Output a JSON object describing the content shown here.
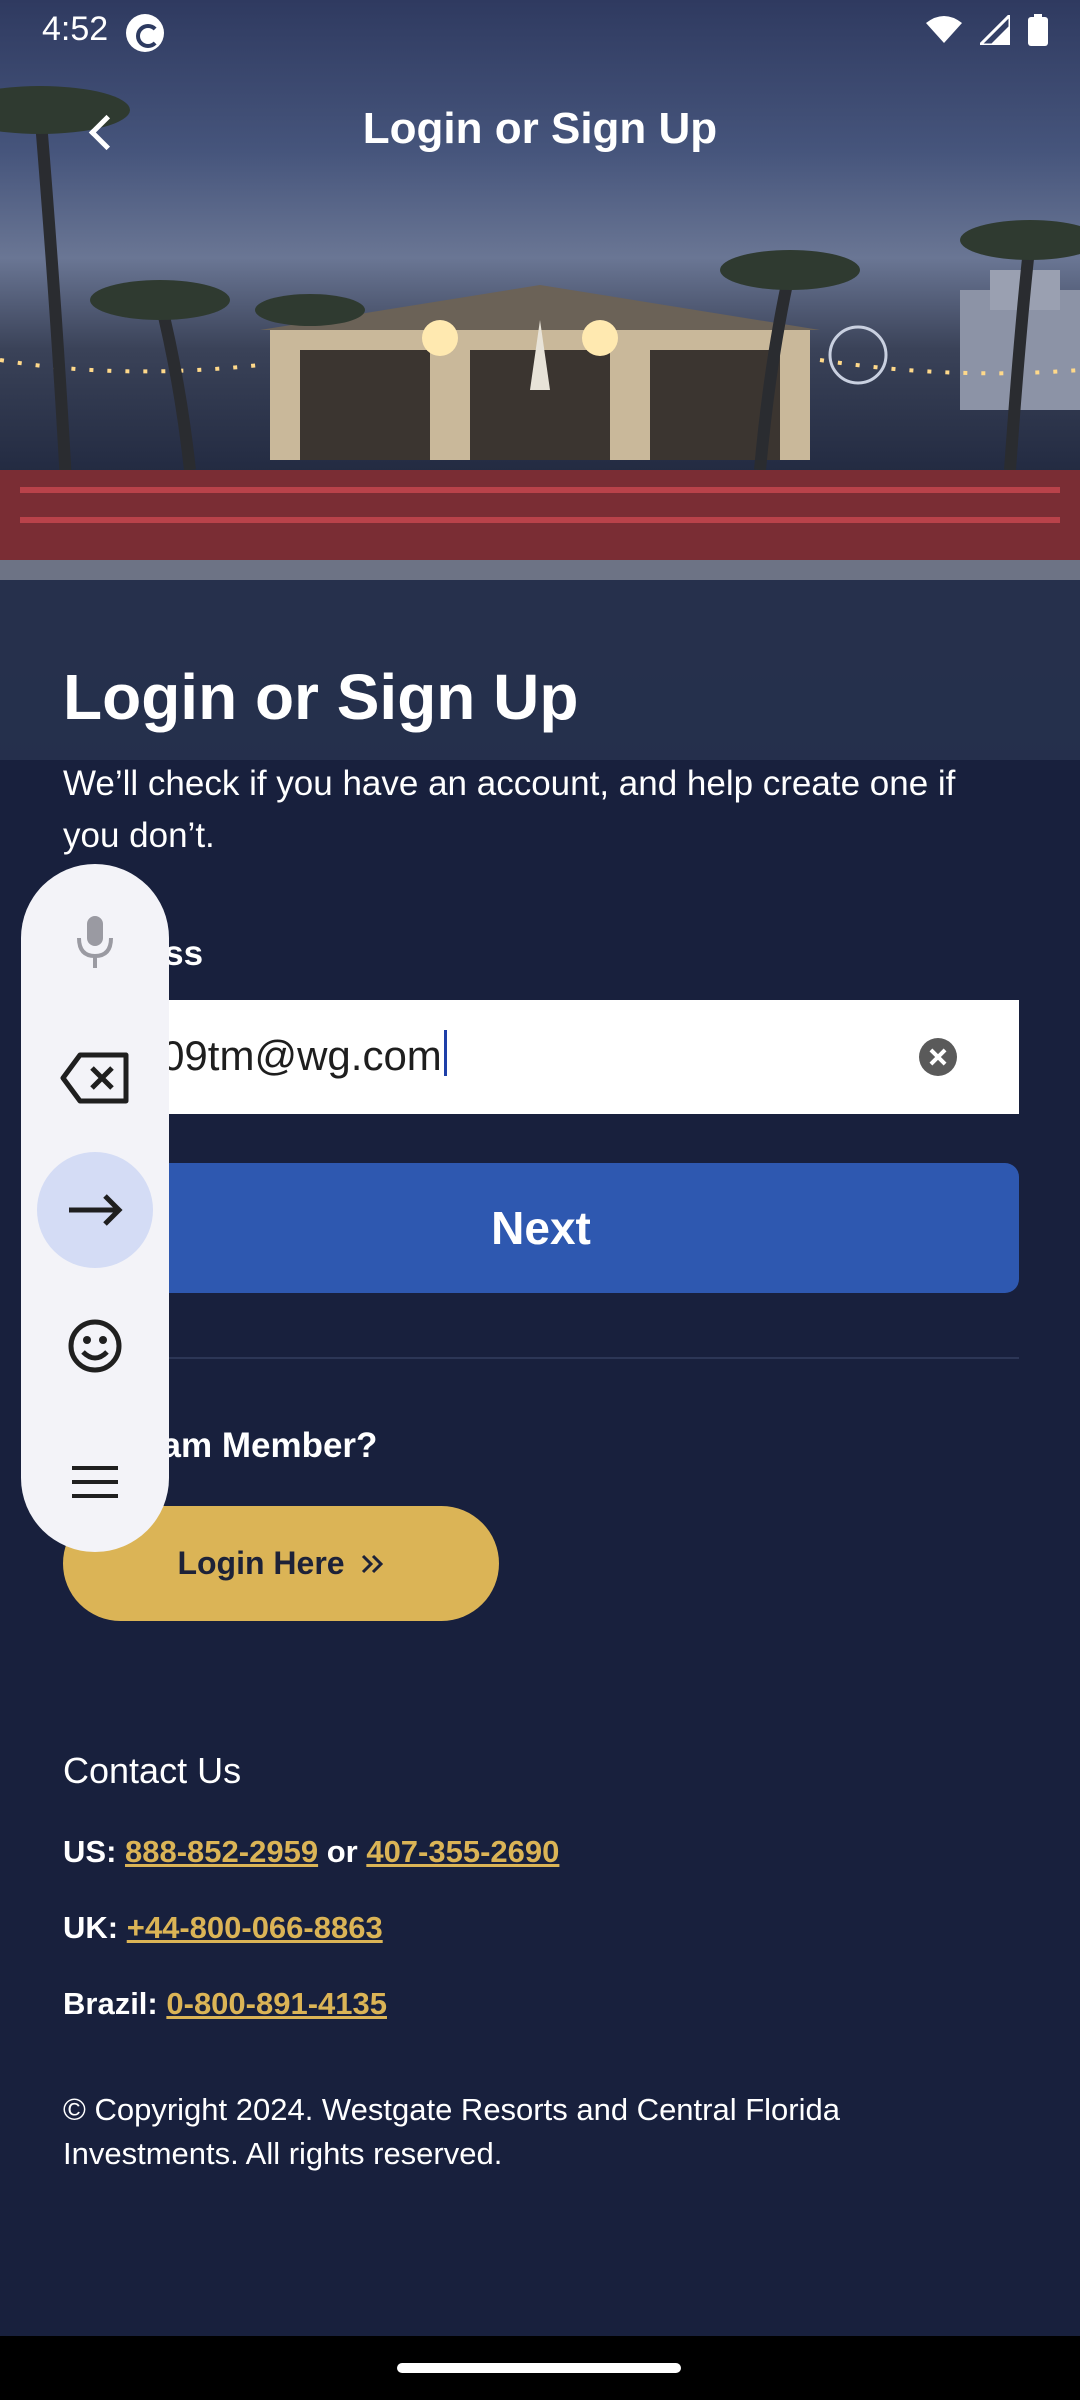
{
  "status_bar": {
    "time": "4:52",
    "icons": [
      "app-sync-icon",
      "wifi-icon",
      "signal-icon",
      "battery-icon"
    ]
  },
  "app_bar": {
    "title": "Login or Sign Up",
    "back_icon": "chevron-left-icon"
  },
  "hero": {
    "scene": "resort pool cabana at dusk with palm trees"
  },
  "form": {
    "heading": "Login or Sign Up",
    "subtitle": "We’ll check if you have an account, and help create one if you don’t.",
    "email_label": "Address",
    "email_value": "25109tm@wg.com",
    "next_label": "Next"
  },
  "team": {
    "heading": "u a Team Member?",
    "login_label": "Login Here",
    "login_icon": "double-chevron-right-icon"
  },
  "contact": {
    "heading": "Contact Us",
    "us_label": "US:",
    "us_phone_1": "888-852-2959",
    "or": "or",
    "us_phone_2": "407-355-2690",
    "uk_label": "UK:",
    "uk_phone": "+44-800-066-8863",
    "brazil_label": "Brazil:",
    "brazil_phone": "0-800-891-4135"
  },
  "copyright": "© Copyright 2024. Westgate Resorts and Central Florida Investments. All rights reserved.",
  "keyboard_tools": [
    "microphone-icon",
    "backspace-icon",
    "arrow-right-icon",
    "emoji-icon",
    "menu-icon"
  ],
  "colors": {
    "background": "#18203d",
    "primary_button": "#2e58b0",
    "accent_gold": "#dbb456",
    "tool_strip": "#f3f3f8",
    "tool_active": "#d4dcf5"
  }
}
